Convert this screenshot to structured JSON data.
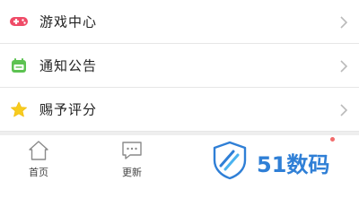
{
  "menu": {
    "items": [
      {
        "label": "游戏中心",
        "icon": "gamepad-icon",
        "icon_color": "#ef4b67"
      },
      {
        "label": "通知公告",
        "icon": "calendar-icon",
        "icon_color": "#5cc251"
      },
      {
        "label": "赐予评分",
        "icon": "star-icon",
        "icon_color": "#f7cc1e"
      }
    ]
  },
  "tabbar": {
    "tabs": [
      {
        "label": "首页",
        "icon": "home-icon"
      },
      {
        "label": "更新",
        "icon": "chat-dots-icon"
      }
    ]
  },
  "watermark": {
    "text": "51数码",
    "color": "#2f7fd6"
  }
}
